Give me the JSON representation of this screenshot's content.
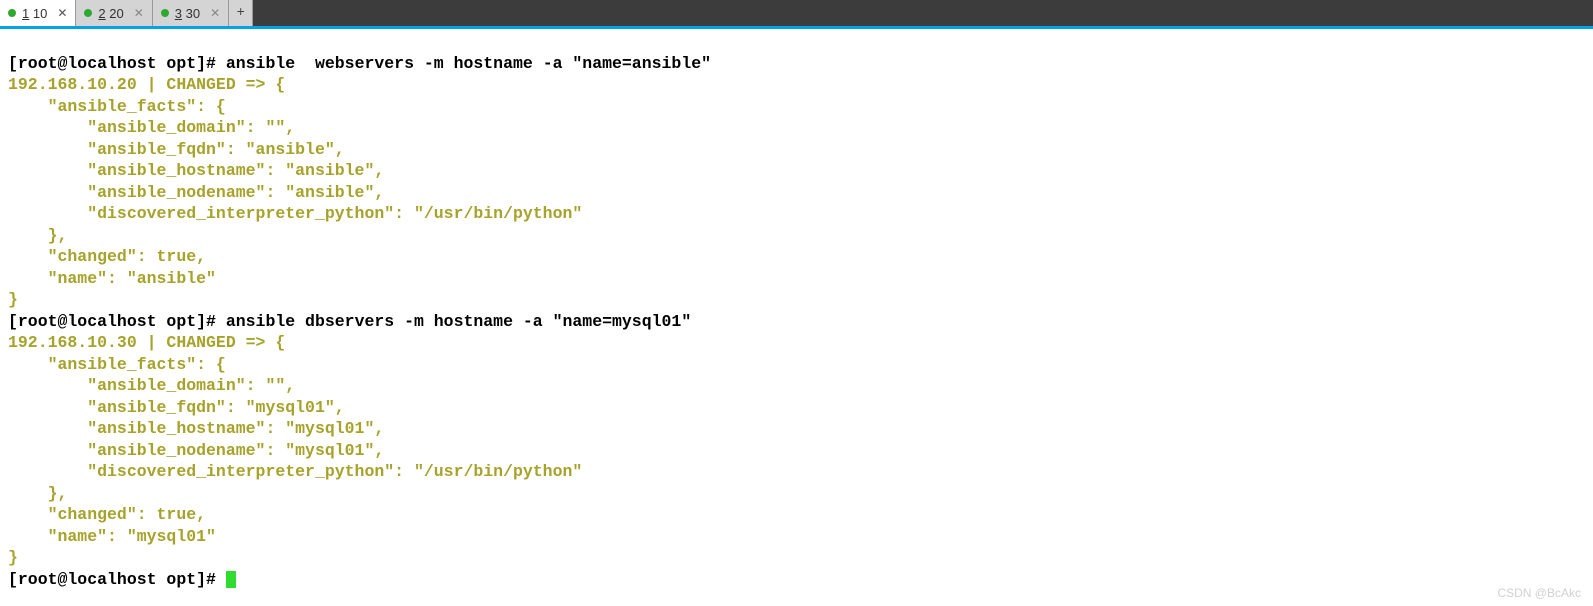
{
  "tabs": [
    {
      "num": "1",
      "label": "10",
      "active": true
    },
    {
      "num": "2",
      "label": "20",
      "active": false
    },
    {
      "num": "3",
      "label": "30",
      "active": false
    }
  ],
  "prompt": "[root@localhost opt]# ",
  "cmd1": "ansible  webservers -m hostname -a \"name=ansible\"",
  "host1": "192.168.10.20 | CHANGED => {",
  "out1": {
    "l1": "    \"ansible_facts\": {",
    "l2": "        \"ansible_domain\": \"\",",
    "l3": "        \"ansible_fqdn\": \"ansible\",",
    "l4": "        \"ansible_hostname\": \"ansible\",",
    "l5": "        \"ansible_nodename\": \"ansible\",",
    "l6": "        \"discovered_interpreter_python\": \"/usr/bin/python\"",
    "l7": "    },",
    "l8": "    \"changed\": true,",
    "l9": "    \"name\": \"ansible\"",
    "l10": "}"
  },
  "cmd2": "ansible dbservers -m hostname -a \"name=mysql01\"",
  "host2": "192.168.10.30 | CHANGED => {",
  "out2": {
    "l1": "    \"ansible_facts\": {",
    "l2": "        \"ansible_domain\": \"\",",
    "l3": "        \"ansible_fqdn\": \"mysql01\",",
    "l4": "        \"ansible_hostname\": \"mysql01\",",
    "l5": "        \"ansible_nodename\": \"mysql01\",",
    "l6": "        \"discovered_interpreter_python\": \"/usr/bin/python\"",
    "l7": "    },",
    "l8": "    \"changed\": true,",
    "l9": "    \"name\": \"mysql01\"",
    "l10": "}"
  },
  "watermark": "CSDN @BcAkc"
}
